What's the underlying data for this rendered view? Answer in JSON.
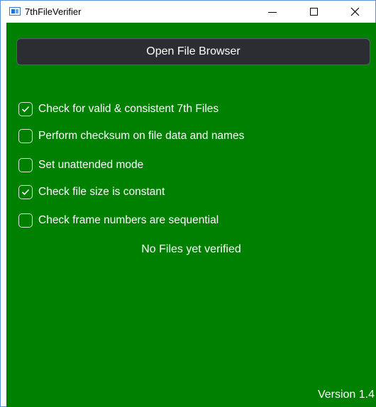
{
  "window": {
    "title": "7thFileVerifier",
    "icon": "app-window-icon"
  },
  "colors": {
    "client_background": "#008000",
    "button_background": "#2b2d33",
    "text": "#ffffff"
  },
  "main": {
    "open_button_label": "Open File Browser",
    "options": [
      {
        "label": "Check for valid & consistent 7th Files",
        "checked": true
      },
      {
        "label": "Perform checksum on file data and names",
        "checked": false
      },
      {
        "label": "Set unattended mode",
        "checked": false
      },
      {
        "label": "Check file size is constant",
        "checked": true
      },
      {
        "label": "Check frame numbers are sequential",
        "checked": false
      }
    ],
    "status_text": "No Files yet verified",
    "version_text": "Version 1.4"
  }
}
